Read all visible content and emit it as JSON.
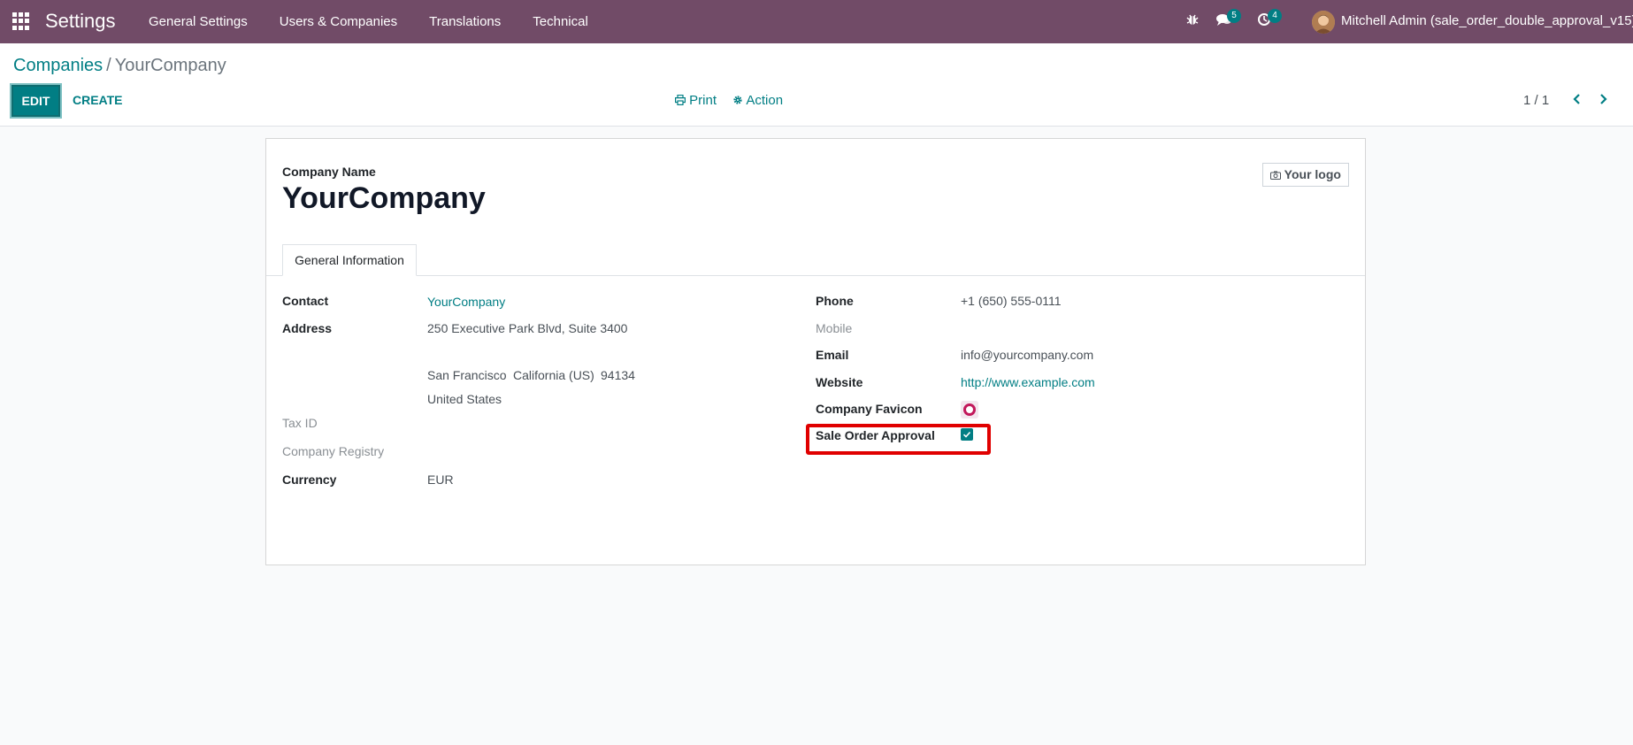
{
  "navbar": {
    "app_title": "Settings",
    "menu": [
      "General Settings",
      "Users & Companies",
      "Translations",
      "Technical"
    ],
    "messages_count": "5",
    "activities_count": "4",
    "user": "Mitchell Admin (sale_order_double_approval_v15)",
    "color": "#714b67"
  },
  "breadcrumb": {
    "parent": "Companies",
    "separator": "/",
    "current": "YourCompany"
  },
  "toolbar": {
    "edit": "EDIT",
    "create": "CREATE",
    "print": "Print",
    "action": "Action"
  },
  "pager": {
    "value": "1 / 1"
  },
  "form": {
    "company_name_label": "Company Name",
    "company_name": "YourCompany",
    "logo_button": "Your logo",
    "tab": "General Information",
    "left": {
      "contact_label": "Contact",
      "contact_value": "YourCompany",
      "address_label": "Address",
      "address_line1": "250 Executive Park Blvd, Suite 3400",
      "address_city": "San Francisco",
      "address_state": "California (US)",
      "address_zip": "94134",
      "address_country": "United States",
      "tax_id_label": "Tax ID",
      "registry_label": "Company Registry",
      "currency_label": "Currency",
      "currency_value": "EUR"
    },
    "right": {
      "phone_label": "Phone",
      "phone_value": "+1 (650) 555-0111",
      "mobile_label": "Mobile",
      "email_label": "Email",
      "email_value": "info@yourcompany.com",
      "website_label": "Website",
      "website_value": "http://www.example.com",
      "favicon_label": "Company Favicon",
      "approval_label": "Sale Order Approval",
      "approval_checked": true
    }
  },
  "colors": {
    "accent": "#017e84",
    "highlight": "#e00000"
  }
}
